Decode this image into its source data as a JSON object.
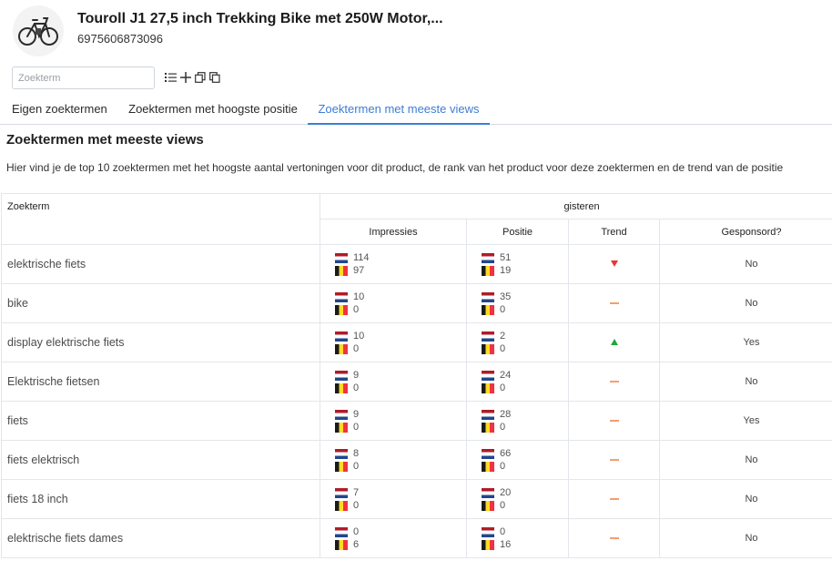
{
  "product": {
    "title": "Touroll J1 27,5 inch Trekking Bike met 250W Motor,...",
    "ean": "6975606873096"
  },
  "search": {
    "placeholder": "Zoekterm"
  },
  "toolbar": {
    "icons": [
      "list-icon",
      "plus-icon",
      "copy-icon",
      "duplicate-icon"
    ]
  },
  "tabs": [
    {
      "label": "Eigen zoektermen",
      "active": false
    },
    {
      "label": "Zoektermen met hoogste positie",
      "active": false
    },
    {
      "label": "Zoektermen met meeste views",
      "active": true
    }
  ],
  "section": {
    "title": "Zoektermen met meeste views",
    "description": "Hier vind je de top 10 zoektermen met het hoogste aantal vertoningen voor dit product, de rank van het product voor deze zoektermen en de trend van de positie"
  },
  "table": {
    "col_term": "Zoekterm",
    "group": "gisteren",
    "col_impressions": "Impressies",
    "col_position": "Positie",
    "col_trend": "Trend",
    "col_sponsored": "Gesponsord?",
    "colors": {
      "down": "#e53935",
      "up": "#1fa83a",
      "flat": "#f0a070"
    },
    "rows": [
      {
        "term": "elektrische fiets",
        "imp_nl": "114",
        "imp_be": "97",
        "pos_nl": "51",
        "pos_be": "19",
        "trend": "down",
        "sponsored": "No"
      },
      {
        "term": "bike",
        "imp_nl": "10",
        "imp_be": "0",
        "pos_nl": "35",
        "pos_be": "0",
        "trend": "flat",
        "sponsored": "No"
      },
      {
        "term": "display elektrische fiets",
        "imp_nl": "10",
        "imp_be": "0",
        "pos_nl": "2",
        "pos_be": "0",
        "trend": "up",
        "sponsored": "Yes"
      },
      {
        "term": "Elektrische fietsen",
        "imp_nl": "9",
        "imp_be": "0",
        "pos_nl": "24",
        "pos_be": "0",
        "trend": "flat",
        "sponsored": "No"
      },
      {
        "term": "fiets",
        "imp_nl": "9",
        "imp_be": "0",
        "pos_nl": "28",
        "pos_be": "0",
        "trend": "flat",
        "sponsored": "Yes"
      },
      {
        "term": "fiets elektrisch",
        "imp_nl": "8",
        "imp_be": "0",
        "pos_nl": "66",
        "pos_be": "0",
        "trend": "flat",
        "sponsored": "No"
      },
      {
        "term": "fiets 18 inch",
        "imp_nl": "7",
        "imp_be": "0",
        "pos_nl": "20",
        "pos_be": "0",
        "trend": "flat",
        "sponsored": "No"
      },
      {
        "term": "elektrische fiets dames",
        "imp_nl": "0",
        "imp_be": "6",
        "pos_nl": "0",
        "pos_be": "16",
        "trend": "flat",
        "sponsored": "No"
      }
    ]
  }
}
